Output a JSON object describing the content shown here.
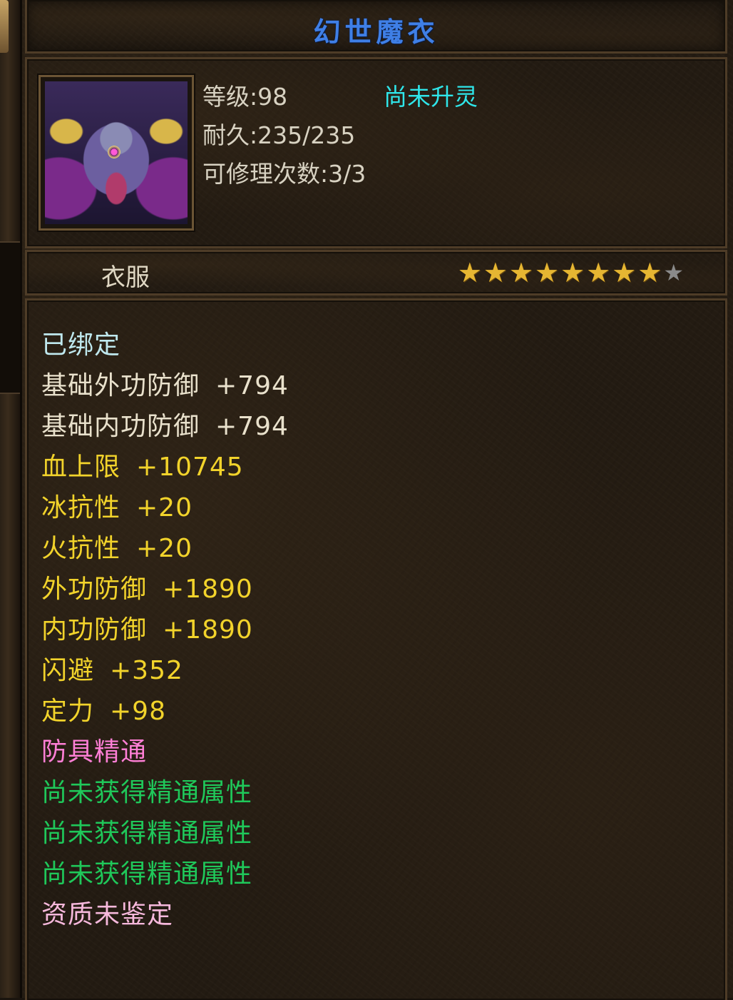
{
  "item": {
    "name": "幻世魔衣",
    "level_label": "等级:98",
    "durability_label": "耐久:235/235",
    "repair_label": "可修理次数:3/3",
    "spirit_status": "尚未升灵",
    "type": "衣服",
    "stars": {
      "filled": 8,
      "total": 9,
      "filled_color": "#e6b632",
      "empty_color": "#8a8a8a"
    }
  },
  "stats": [
    {
      "label": "已绑定",
      "value": "",
      "color": "bound"
    },
    {
      "label": "基础外功防御",
      "value": "+794",
      "color": "base"
    },
    {
      "label": "基础内功防御",
      "value": "+794",
      "color": "base"
    },
    {
      "label": "血上限",
      "value": "+10745",
      "color": "yellow"
    },
    {
      "label": "冰抗性",
      "value": "+20",
      "color": "yellow"
    },
    {
      "label": "火抗性",
      "value": "+20",
      "color": "yellow"
    },
    {
      "label": "外功防御",
      "value": "+1890",
      "color": "yellow"
    },
    {
      "label": "内功防御",
      "value": "+1890",
      "color": "yellow"
    },
    {
      "label": "闪避",
      "value": "+352",
      "color": "yellow"
    },
    {
      "label": "定力",
      "value": "+98",
      "color": "yellow"
    },
    {
      "label": "防具精通",
      "value": "",
      "color": "pink"
    },
    {
      "label": "尚未获得精通属性",
      "value": "",
      "color": "green"
    },
    {
      "label": "尚未获得精通属性",
      "value": "",
      "color": "green"
    },
    {
      "label": "尚未获得精通属性",
      "value": "",
      "color": "green"
    },
    {
      "label": "资质未鉴定",
      "value": "",
      "color": "quality"
    }
  ],
  "colors": {
    "title": "#3f7fe6",
    "spirit": "#2fe6ea",
    "bound": "#bfe8ee",
    "base": "#e9e1cc",
    "yellow": "#f2d32b",
    "pink": "#ff7fd6",
    "green": "#1fc85a",
    "quality": "#f6b8dc"
  },
  "icons": {
    "portrait": "demon-robe-armor-icon",
    "star": "star-icon"
  }
}
